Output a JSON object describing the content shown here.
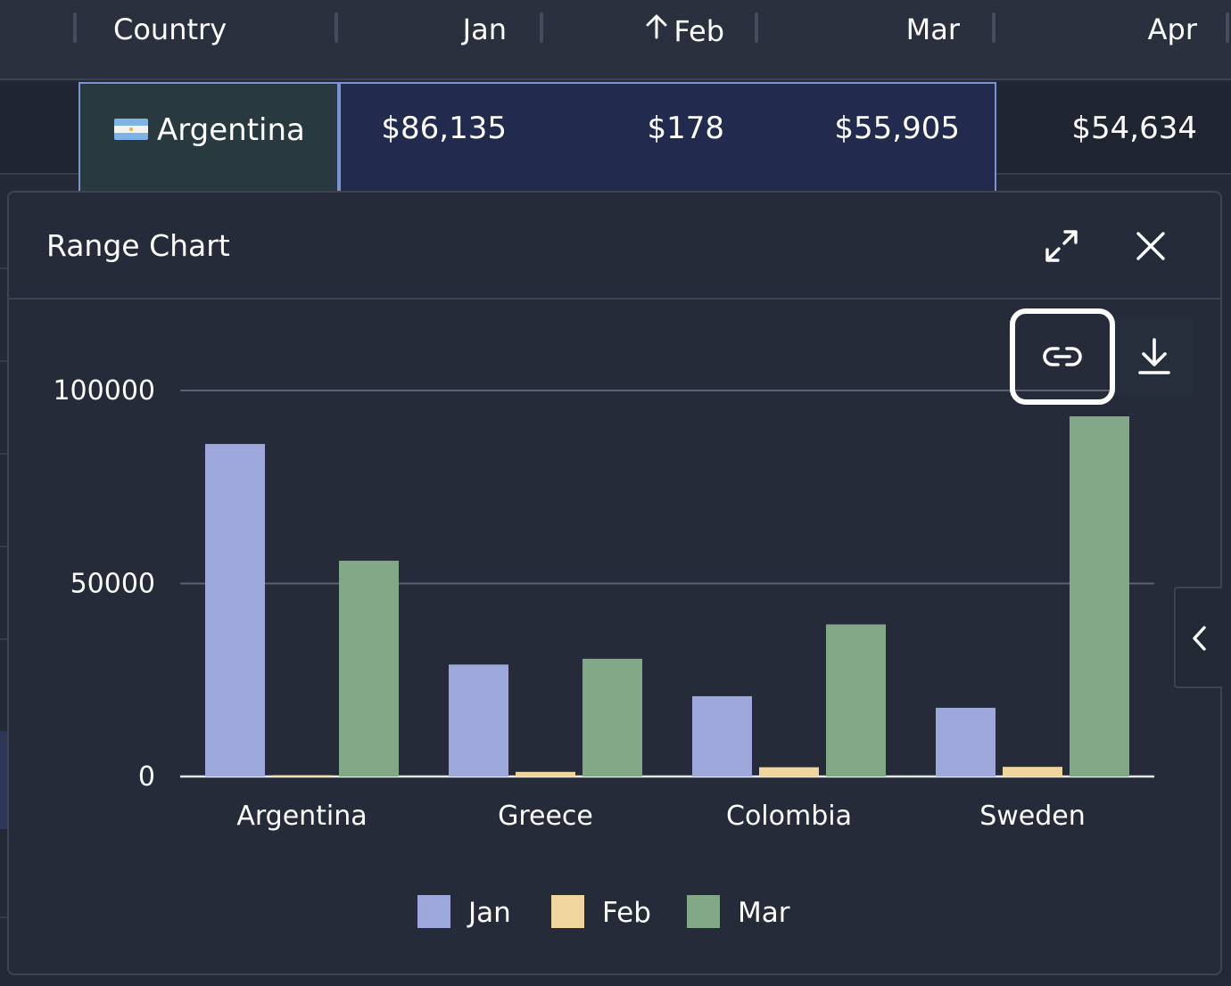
{
  "grid": {
    "columns": [
      {
        "label": "Country"
      },
      {
        "label": "Jan"
      },
      {
        "label": "Feb",
        "sort_icon": "arrow-up-icon"
      },
      {
        "label": "Mar"
      },
      {
        "label": "Apr"
      }
    ],
    "row": {
      "flag_icon": "argentina-flag-icon",
      "country": "Argentina",
      "jan": "$86,135",
      "feb": "$178",
      "mar": "$55,905",
      "apr": "$54,634"
    }
  },
  "panel": {
    "title": "Range Chart",
    "expand_icon": "expand-icon",
    "close_icon": "close-icon",
    "link_icon": "link-icon",
    "download_icon": "download-icon",
    "side_tab_icon": "chevron-left-icon"
  },
  "colors": {
    "jan": "#9ea8db",
    "feb": "#eed69c",
    "mar": "#82a888",
    "selection_border": "#7d93cf"
  },
  "chart_data": {
    "type": "bar",
    "title": "",
    "xlabel": "",
    "ylabel": "",
    "categories": [
      "Argentina",
      "Greece",
      "Colombia",
      "Sweden"
    ],
    "series": [
      {
        "name": "Jan",
        "values": [
          86135,
          29000,
          20800,
          17800
        ]
      },
      {
        "name": "Feb",
        "values": [
          178,
          1200,
          2400,
          2500
        ]
      },
      {
        "name": "Mar",
        "values": [
          55905,
          30500,
          39400,
          93300
        ]
      }
    ],
    "ylim": [
      0,
      100000
    ],
    "yticks": [
      "0",
      "50000",
      "100000"
    ],
    "grid": true,
    "legend": "bottom"
  }
}
